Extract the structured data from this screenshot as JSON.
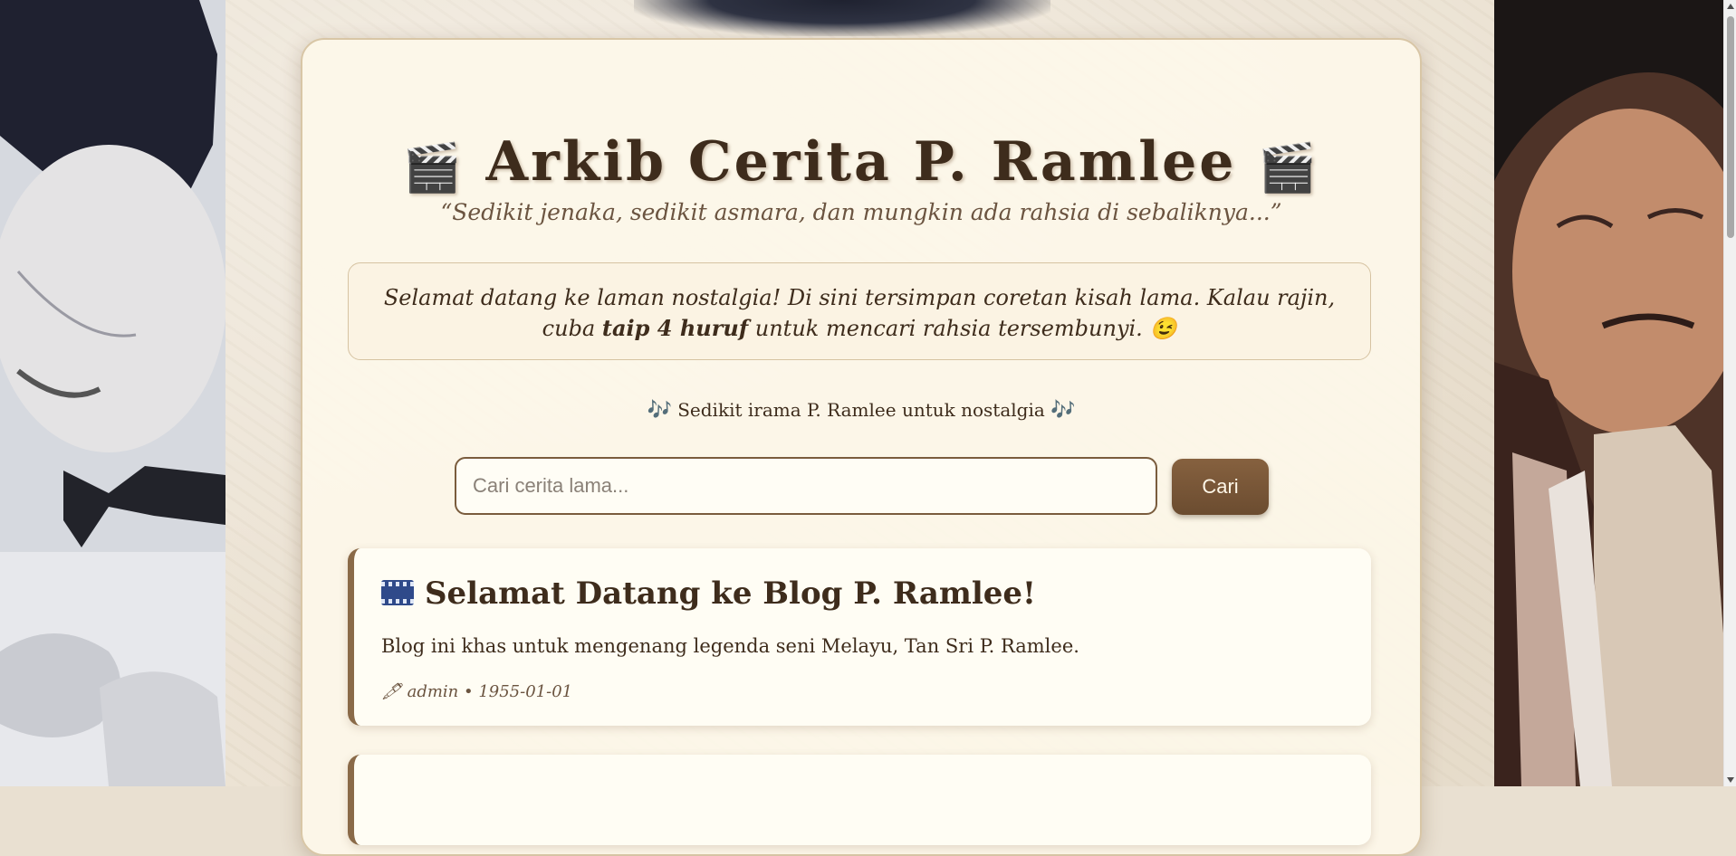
{
  "page": {
    "title_icon": "clapperboard-icon",
    "title_icon_glyph": "🎬",
    "title": "Arkib Cerita P. Ramlee",
    "subtitle": "“Sedikit jenaka, sedikit asmara, dan mungkin ada rahsia di sebaliknya...”"
  },
  "notice": {
    "text_before": "Selamat datang ke laman nostalgia! Di sini tersimpan coretan kisah lama. Kalau rajin, cuba ",
    "text_bold": "taip 4 huruf",
    "text_after": " untuk mencari rahsia tersembunyi. ",
    "emoji": "😉"
  },
  "music": {
    "icon": "music-notes-icon",
    "icon_glyph": "🎶",
    "text": "Sedikit irama P. Ramlee untuk nostalgia"
  },
  "search": {
    "placeholder": "Cari cerita lama...",
    "value": "",
    "button_label": "Cari"
  },
  "posts": [
    {
      "icon": "film-frames-icon",
      "title": "Selamat Datang ke Blog P. Ramlee!",
      "excerpt": "Blog ini khas untuk mengenang legenda seni Melayu, Tan Sri P. Ramlee.",
      "meta_icon": "pen-icon",
      "meta_icon_glyph": "🖋",
      "meta": "admin • 1955-01-01"
    }
  ],
  "colors": {
    "accent_brown": "#7a5c3d",
    "text_dark": "#3e2c1c",
    "card_bg": "#fdf7ea"
  }
}
